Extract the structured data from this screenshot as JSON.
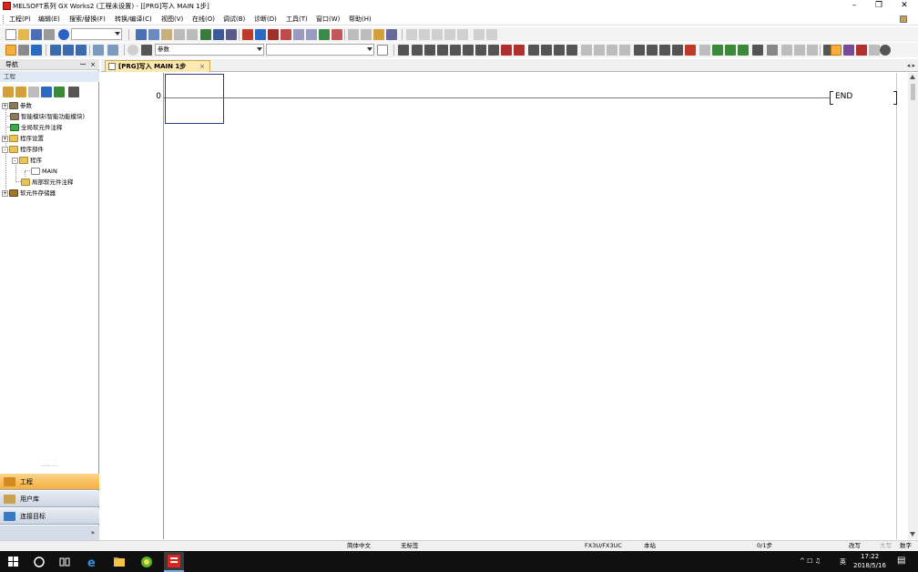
{
  "window": {
    "title": "MELSOFT系列 GX Works2 (工程未设置) - [[PRG]写入 MAIN 1步]",
    "minimize_label": "–",
    "restore_label": "❐",
    "close_label": "✕"
  },
  "menubar": {
    "items": [
      {
        "label": "工程(P)"
      },
      {
        "label": "编辑(E)"
      },
      {
        "label": "搜索/替换(F)"
      },
      {
        "label": "转换/编译(C)"
      },
      {
        "label": "视图(V)"
      },
      {
        "label": "在线(O)"
      },
      {
        "label": "调试(B)"
      },
      {
        "label": "诊断(D)"
      },
      {
        "label": "工具(T)"
      },
      {
        "label": "窗口(W)"
      },
      {
        "label": "帮助(H)"
      }
    ],
    "mdi_min": "-",
    "mdi_close": "×"
  },
  "toolbar": {
    "combo1_value": "",
    "combo2_value": "参数",
    "combo3_value": ""
  },
  "navigation": {
    "title": "导航",
    "pin": "ꟷ",
    "close": "×",
    "section": "工程",
    "tree": [
      {
        "label": "参数"
      },
      {
        "label": "智能模块(智能功能模块)"
      },
      {
        "label": "全局软元件注释"
      },
      {
        "label": "程序设置"
      },
      {
        "label": "程序部件"
      },
      {
        "label": "程序"
      },
      {
        "label": "MAIN"
      },
      {
        "label": "局部软元件注释"
      },
      {
        "label": "软元件存储器"
      }
    ],
    "buttons": {
      "project": "工程",
      "library": "用户库",
      "connection": "连接目标"
    },
    "more": "»"
  },
  "document": {
    "tab_label": "[PRG]写入 MAIN 1步",
    "tab_close": "×",
    "tab_nav": "◂ ▸"
  },
  "ladder": {
    "step": "0",
    "end_label": "END"
  },
  "statusbar": {
    "lang": "简体中文",
    "label": "无标签",
    "plc": "FX3U/FX3UC",
    "station": "本站",
    "steps": "0/1步",
    "mode": "改写",
    "caps": "大写",
    "num": "数字"
  },
  "taskbar": {
    "time": "17:22",
    "date": "2018/5/16",
    "ime": "英",
    "tray_icons": "^ ☐ ♫"
  },
  "colors": {
    "accent_orange": "#f6ae3d",
    "cursor_blue": "#2b3e8c",
    "taskbar": "#101010"
  }
}
